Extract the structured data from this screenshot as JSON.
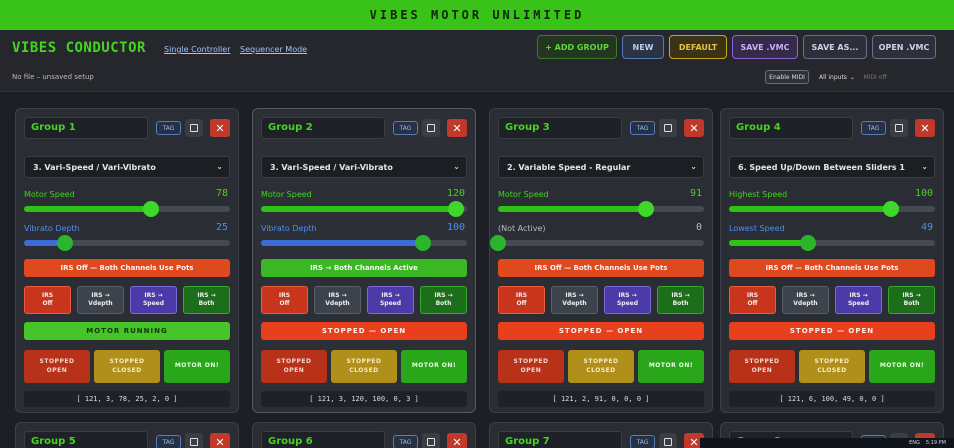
{
  "window": {
    "title": "VIBES MOTOR UNLIMITED"
  },
  "header": {
    "app_title": "VIBES CONDUCTOR",
    "modes": [
      "Single Controller",
      "Sequencer Mode"
    ],
    "file_status": "No file – unsaved setup",
    "buttons": {
      "add_group": "+ ADD GROUP",
      "new": "NEW",
      "default": "DEFAULT",
      "save_vmc": "SAVE .VMC",
      "save_as": "SAVE AS...",
      "open_vmc": "OPEN .VMC"
    },
    "midi": {
      "enable": "Enable MIDI",
      "inputs": "All inputs",
      "status": "MIDI off"
    }
  },
  "groups": [
    {
      "name": "Group 1",
      "tag": "TAG",
      "mode": "3. Vari-Speed / Vari-Vibrato",
      "s1": {
        "label": "Motor Speed",
        "value": 78,
        "value_text": "78"
      },
      "s2": {
        "label": "Vibrato Depth",
        "value": 25,
        "value_text": "25"
      },
      "irs_status": "IRS Off — Both Channels Use Pots",
      "irs": [
        {
          "l1": "IRS",
          "l2": "Off"
        },
        {
          "l1": "IRS →",
          "l2": "Vdepth"
        },
        {
          "l1": "IRS →",
          "l2": "Speed"
        },
        {
          "l1": "IRS →",
          "l2": "Both"
        }
      ],
      "status": "MOTOR RUNNING",
      "states": [
        {
          "l1": "STOPPED",
          "l2": "OPEN"
        },
        {
          "l1": "STOPPED",
          "l2": "CLOSED"
        },
        {
          "l1": "MOTOR ON!",
          "l2": ""
        }
      ],
      "values": "[ 121, 3, 78, 25, 2, 0 ]"
    },
    {
      "name": "Group 2",
      "tag": "TAG",
      "mode": "3. Vari-Speed / Vari-Vibrato",
      "s1": {
        "label": "Motor Speed",
        "value": 120,
        "value_text": "120"
      },
      "s2": {
        "label": "Vibrato Depth",
        "value": 100,
        "value_text": "100"
      },
      "irs_status": "IRS → Both Channels Active",
      "irs": [
        {
          "l1": "IRS",
          "l2": "Off"
        },
        {
          "l1": "IRS →",
          "l2": "Vdepth"
        },
        {
          "l1": "IRS →",
          "l2": "Speed"
        },
        {
          "l1": "IRS →",
          "l2": "Both"
        }
      ],
      "status": "STOPPED — OPEN",
      "states": [
        {
          "l1": "STOPPED",
          "l2": "OPEN"
        },
        {
          "l1": "STOPPED",
          "l2": "CLOSED"
        },
        {
          "l1": "MOTOR ON!",
          "l2": ""
        }
      ],
      "values": "[ 121, 3, 120, 100, 0, 3 ]"
    },
    {
      "name": "Group 3",
      "tag": "TAG",
      "mode": "2. Variable Speed - Regular",
      "s1": {
        "label": "Motor Speed",
        "value": 91,
        "value_text": "91"
      },
      "s2": {
        "label": "(Not Active)",
        "value": 0,
        "value_text": "0"
      },
      "irs_status": "IRS Off — Both Channels Use Pots",
      "irs": [
        {
          "l1": "IRS",
          "l2": "Off"
        },
        {
          "l1": "IRS →",
          "l2": "Vdepth"
        },
        {
          "l1": "IRS →",
          "l2": "Speed"
        },
        {
          "l1": "IRS →",
          "l2": "Both"
        }
      ],
      "status": "STOPPED — OPEN",
      "states": [
        {
          "l1": "STOPPED",
          "l2": "OPEN"
        },
        {
          "l1": "STOPPED",
          "l2": "CLOSED"
        },
        {
          "l1": "MOTOR ON!",
          "l2": ""
        }
      ],
      "values": "[ 121, 2, 91, 0, 0, 0 ]"
    },
    {
      "name": "Group 4",
      "tag": "TAG",
      "mode": "6. Speed Up/Down Between Sliders 1",
      "s1": {
        "label": "Highest Speed",
        "value": 100,
        "value_text": "100"
      },
      "s2": {
        "label": "Lowest Speed",
        "value": 49,
        "value_text": "49"
      },
      "irs_status": "IRS Off — Both Channels Use Pots",
      "irs": [
        {
          "l1": "IRS",
          "l2": "Off"
        },
        {
          "l1": "IRS →",
          "l2": "Vdepth"
        },
        {
          "l1": "IRS →",
          "l2": "Speed"
        },
        {
          "l1": "IRS →",
          "l2": "Both"
        }
      ],
      "status": "STOPPED — OPEN",
      "states": [
        {
          "l1": "STOPPED",
          "l2": "OPEN"
        },
        {
          "l1": "STOPPED",
          "l2": "CLOSED"
        },
        {
          "l1": "MOTOR ON!",
          "l2": ""
        }
      ],
      "values": "[ 121, 6, 100, 49, 0, 0 ]"
    }
  ],
  "collapsed_groups": [
    {
      "name": "Group 5",
      "tag": "TAG"
    },
    {
      "name": "Group 6",
      "tag": "TAG"
    },
    {
      "name": "Group 7",
      "tag": "TAG"
    },
    {
      "name": "Group 8",
      "tag": "TAG"
    }
  ],
  "taskbar": {
    "lang": "ENG",
    "time": "5:19 PM"
  },
  "colors": {
    "accent_green": "#46d421",
    "red": "#e8401c",
    "blue": "#3d6bd8",
    "yellow": "#c9a81d"
  }
}
